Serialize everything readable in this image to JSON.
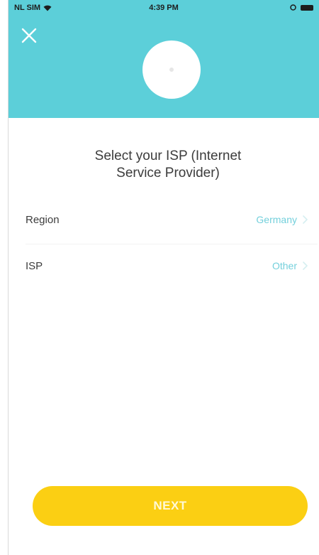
{
  "status_bar": {
    "carrier": "NL SIM",
    "time": "4:39 PM"
  },
  "header": {
    "close_icon": "close-icon",
    "device_icon": "device-circle",
    "background_color": "#5ccfd9"
  },
  "title": {
    "line1": "Select your ISP (Internet",
    "line2": "Service Provider)"
  },
  "rows": [
    {
      "label": "Region",
      "value": "Germany"
    },
    {
      "label": "ISP",
      "value": "Other"
    }
  ],
  "next_button": {
    "label": "NEXT",
    "color": "#fbcf13"
  },
  "accent_color": "#74d0dc"
}
